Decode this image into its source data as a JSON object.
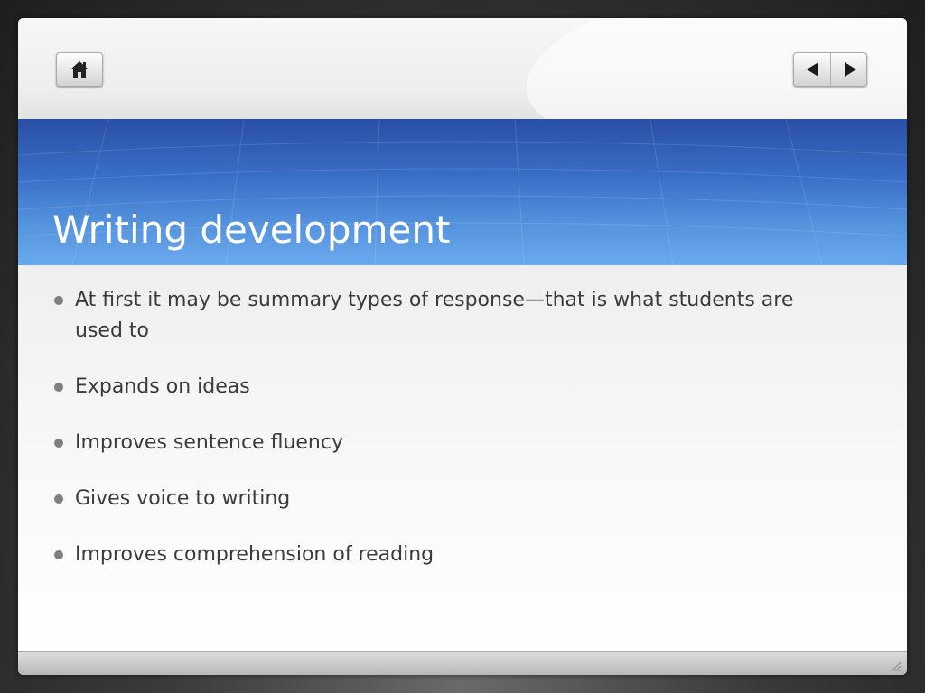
{
  "slide": {
    "title": "Writing development",
    "bullets": [
      "At first it may be summary types of response—that is what students are used to",
      "Expands on ideas",
      "Improves sentence fluency",
      "Gives voice to writing",
      "Improves comprehension of reading"
    ]
  },
  "navigation": {
    "home_icon": "home-icon",
    "previous_icon": "triangle-left-icon",
    "next_icon": "triangle-right-icon"
  },
  "colors": {
    "title_band_top": "#2a4fa5",
    "title_band_bottom": "#6aa8ee",
    "title_text": "#ffffff",
    "body_text": "#3b3b3b",
    "bullet": "#7f7f7f"
  }
}
